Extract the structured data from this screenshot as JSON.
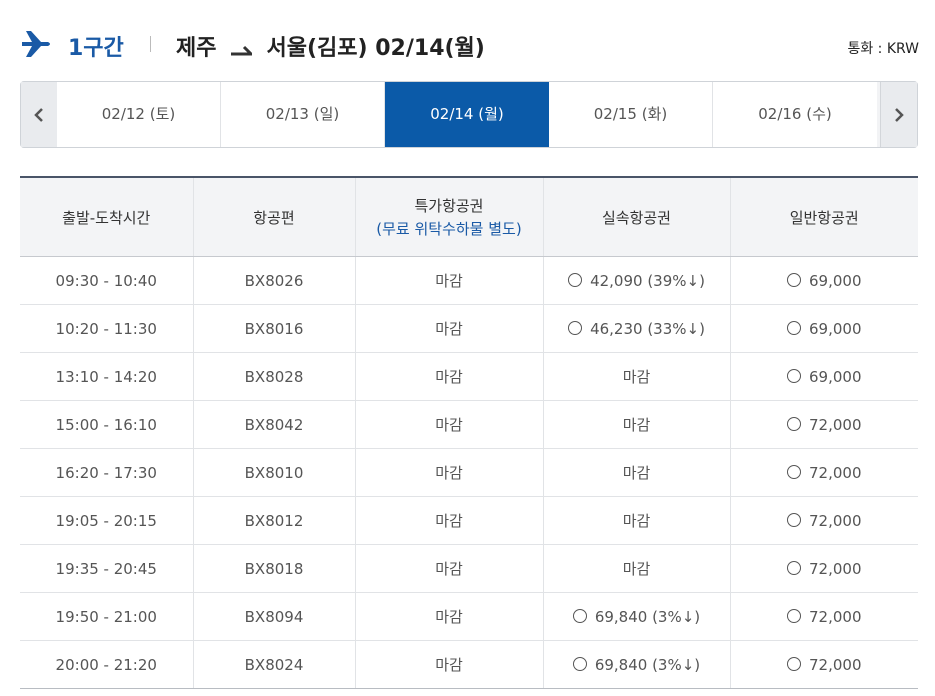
{
  "header": {
    "segment": "1구간",
    "origin": "제주",
    "destination": "서울(김포)",
    "date": "02/14(월)",
    "currency": "통화 : KRW"
  },
  "date_nav": {
    "dates": [
      {
        "label": "02/12 (토)",
        "active": false
      },
      {
        "label": "02/13 (일)",
        "active": false
      },
      {
        "label": "02/14 (월)",
        "active": true
      },
      {
        "label": "02/15 (화)",
        "active": false
      },
      {
        "label": "02/16 (수)",
        "active": false
      }
    ],
    "prev_icon": "chevron-left-icon",
    "next_icon": "chevron-right-icon"
  },
  "table": {
    "headers": {
      "time": "출발-도착시간",
      "flight": "항공편",
      "special": "특가항공권",
      "special_note": "(무료 위탁수하물 별도)",
      "discount": "실속항공권",
      "regular": "일반항공권"
    },
    "rows": [
      {
        "time": "09:30 - 10:40",
        "flight": "BX8026",
        "special": "마감",
        "discount": "42,090 (39%↓)",
        "discount_selectable": true,
        "regular": "69,000"
      },
      {
        "time": "10:20 - 11:30",
        "flight": "BX8016",
        "special": "마감",
        "discount": "46,230 (33%↓)",
        "discount_selectable": true,
        "regular": "69,000"
      },
      {
        "time": "13:10 - 14:20",
        "flight": "BX8028",
        "special": "마감",
        "discount": "마감",
        "discount_selectable": false,
        "regular": "69,000"
      },
      {
        "time": "15:00 - 16:10",
        "flight": "BX8042",
        "special": "마감",
        "discount": "마감",
        "discount_selectable": false,
        "regular": "72,000"
      },
      {
        "time": "16:20 - 17:30",
        "flight": "BX8010",
        "special": "마감",
        "discount": "마감",
        "discount_selectable": false,
        "regular": "72,000"
      },
      {
        "time": "19:05 - 20:15",
        "flight": "BX8012",
        "special": "마감",
        "discount": "마감",
        "discount_selectable": false,
        "regular": "72,000"
      },
      {
        "time": "19:35 - 20:45",
        "flight": "BX8018",
        "special": "마감",
        "discount": "마감",
        "discount_selectable": false,
        "regular": "72,000"
      },
      {
        "time": "19:50 - 21:00",
        "flight": "BX8094",
        "special": "마감",
        "discount": "69,840 (3%↓)",
        "discount_selectable": true,
        "regular": "72,000"
      },
      {
        "time": "20:00 - 21:20",
        "flight": "BX8024",
        "special": "마감",
        "discount": "69,840 (3%↓)",
        "discount_selectable": true,
        "regular": "72,000"
      }
    ]
  },
  "colors": {
    "accent": "#1a5aa6",
    "active_date": "#0b5aa8",
    "header_bg": "#f3f4f6"
  }
}
